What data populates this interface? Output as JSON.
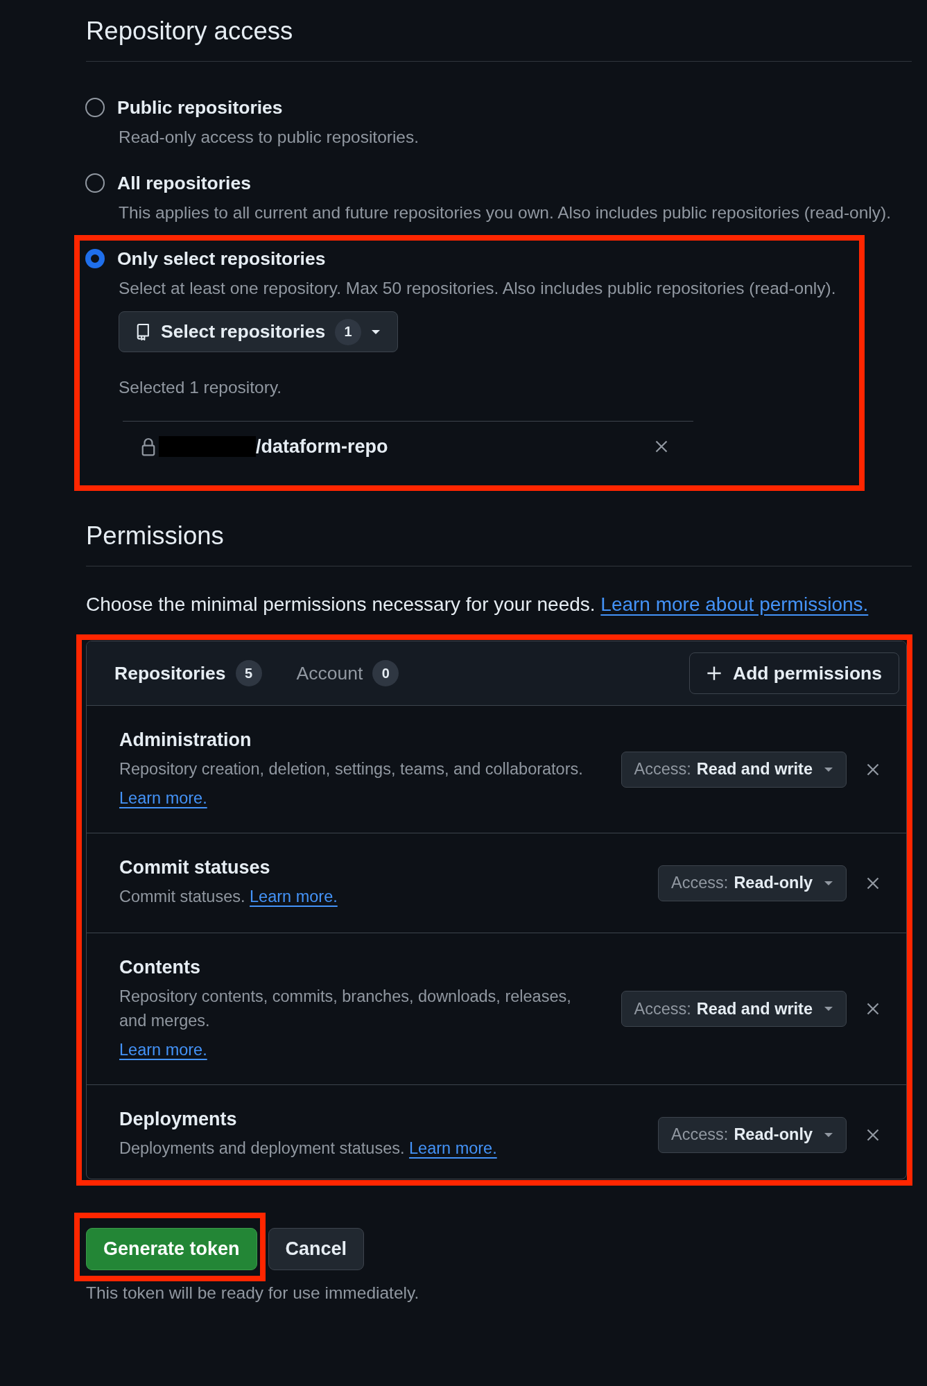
{
  "repository_access": {
    "title": "Repository access",
    "options": [
      {
        "label": "Public repositories",
        "description": "Read-only access to public repositories.",
        "selected": false,
        "highlighted": false
      },
      {
        "label": "All repositories",
        "description": "This applies to all current and future repositories you own. Also includes public repositories (read-only).",
        "selected": false,
        "highlighted": false
      },
      {
        "label": "Only select repositories",
        "description": "Select at least one repository. Max 50 repositories. Also includes public repositories (read-only).",
        "selected": true,
        "highlighted": true
      }
    ],
    "select_button": {
      "label": "Select repositories",
      "count": "1"
    },
    "selected_summary": "Selected 1 repository.",
    "selected_repositories": [
      {
        "name": "/dataform-repo",
        "owner_redacted": true
      }
    ]
  },
  "permissions": {
    "title": "Permissions",
    "intro": "Choose the minimal permissions necessary for your needs.",
    "intro_link": "Learn more about permissions.",
    "highlighted": true,
    "tabs": [
      {
        "label": "Repositories",
        "count": "5",
        "selected": true
      },
      {
        "label": "Account",
        "count": "0",
        "selected": false
      }
    ],
    "add_button": "Add permissions",
    "items": [
      {
        "name": "Administration",
        "description": "Repository creation, deletion, settings, teams, and collaborators.",
        "link": "Learn more.",
        "kind": "link_below",
        "access_label": "Access:",
        "access": "Read and write"
      },
      {
        "name": "Commit statuses",
        "description": "Commit statuses.",
        "link": "Learn more.",
        "kind": "link_inline",
        "access_label": "Access:",
        "access": "Read-only"
      },
      {
        "name": "Contents",
        "description": "Repository contents, commits, branches, downloads, releases, and merges.",
        "link": "Learn more.",
        "kind": "link_below",
        "access_label": "Access:",
        "access": "Read and write"
      },
      {
        "name": "Deployments",
        "description": "Deployments and deployment statuses.",
        "link": "Learn more.",
        "kind": "link_inline",
        "access_label": "Access:",
        "access": "Read-only"
      }
    ]
  },
  "actions": {
    "generate": {
      "label": "Generate token",
      "highlighted": true
    },
    "cancel": "Cancel",
    "note": "This token will be ready for use immediately."
  }
}
